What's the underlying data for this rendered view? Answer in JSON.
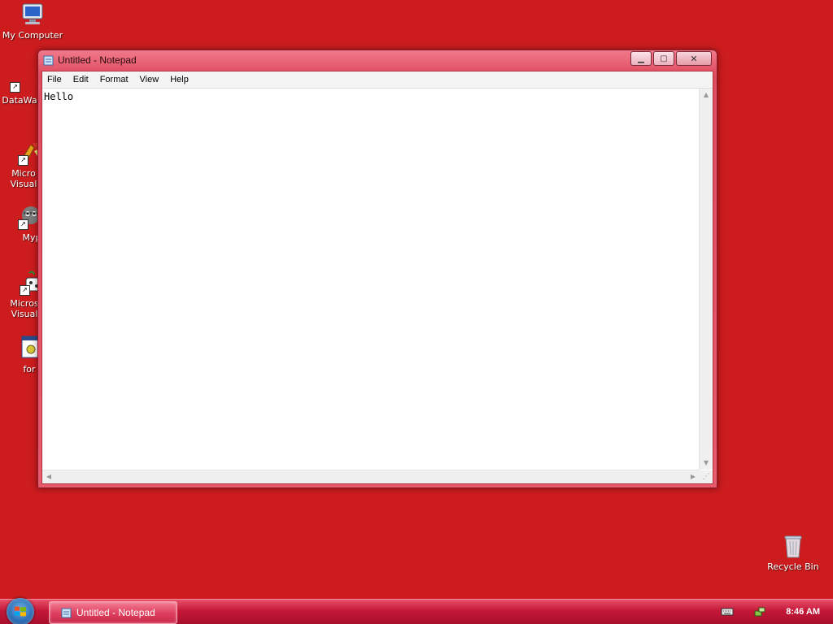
{
  "desktop": {
    "icons": [
      {
        "label": "My Computer"
      },
      {
        "label": "DataWa"
      },
      {
        "label": "Micro\nVisual"
      },
      {
        "label": "Myp"
      },
      {
        "label": "Micros\nVisual"
      },
      {
        "label": "for"
      },
      {
        "label": "Recycle Bin"
      }
    ]
  },
  "window": {
    "title": "Untitled - Notepad",
    "menu": [
      "File",
      "Edit",
      "Format",
      "View",
      "Help"
    ],
    "content": "Hello"
  },
  "taskbar": {
    "task_label": "Untitled - Notepad",
    "clock": "8:46 AM"
  },
  "colors": {
    "desktop_bg": "#cc1c1e",
    "taskbar": "#c41838"
  }
}
